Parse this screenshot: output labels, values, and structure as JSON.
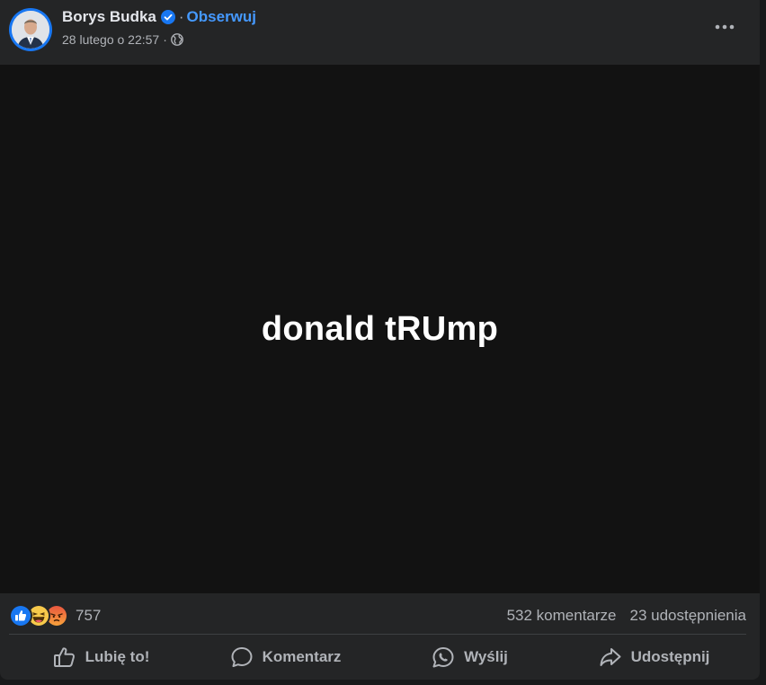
{
  "post": {
    "author": "Borys Budka",
    "follow_label": "Obserwuj",
    "separator": "·",
    "timestamp": "28 lutego o 22:57",
    "audience_icon": "globe-icon",
    "media_text": "donald tRUmp",
    "reaction_icons": [
      "like-reaction-icon",
      "haha-reaction-icon",
      "angry-reaction-icon"
    ],
    "reaction_count": "757",
    "comments": "532 komentarze",
    "shares": "23 udostępnienia"
  },
  "actions": {
    "like": "Lubię to!",
    "comment": "Komentarz",
    "send": "Wyślij",
    "share": "Udostępnij"
  },
  "colors": {
    "background": "#18191a",
    "card": "#242526",
    "media_bg": "#121212",
    "accent": "#4599ff",
    "text_primary": "#e4e6eb",
    "text_secondary": "#b0b3b8"
  }
}
